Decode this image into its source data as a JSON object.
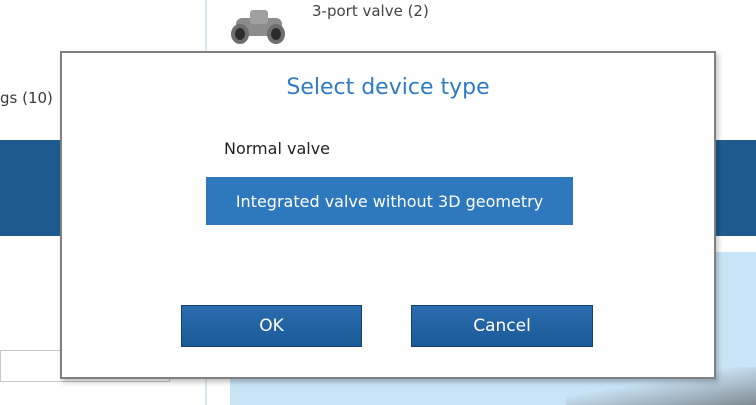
{
  "background": {
    "top_item": {
      "label": "3-port valve (2)",
      "icon": "valve-icon"
    },
    "left_item": {
      "label": "gs (10)"
    }
  },
  "dialog": {
    "title": "Select device type",
    "options": [
      {
        "label": "Normal valve",
        "selected": false
      },
      {
        "label": "Integrated valve without 3D geometry",
        "selected": true
      }
    ],
    "ok_label": "OK",
    "cancel_label": "Cancel"
  },
  "colors": {
    "accent": "#2e78bd",
    "title": "#2f7bc4",
    "button": "#1f5f9f",
    "panel_light_blue": "#c9e3f7",
    "dark_bar": "#1f5a8f"
  }
}
